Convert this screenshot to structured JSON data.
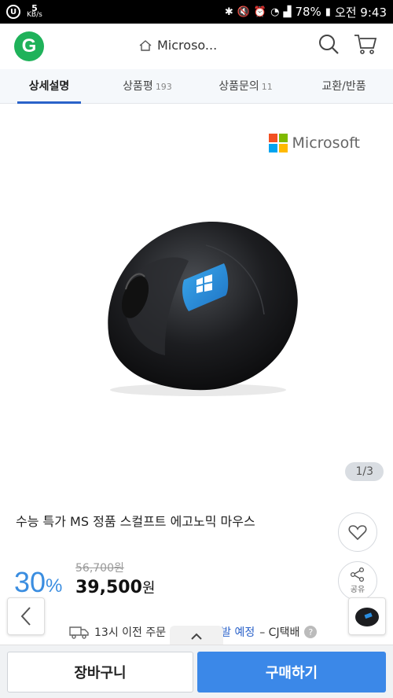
{
  "status_bar": {
    "speed_value": "5",
    "speed_unit": "KB/s",
    "battery": "78%",
    "time": "오전 9:43"
  },
  "header": {
    "logo_letter": "G",
    "title": "Microso..."
  },
  "tabs": [
    {
      "label": "상세설명",
      "count": ""
    },
    {
      "label": "상품평",
      "count": "193"
    },
    {
      "label": "상품문의",
      "count": "11"
    },
    {
      "label": "교환/반품",
      "count": ""
    }
  ],
  "image": {
    "brand_text": "Microsoft",
    "pager": "1/3"
  },
  "product": {
    "title": "수능 특가 MS 정품 스컬프트 에고노믹 마우스",
    "original_price": "56,700원",
    "discount_value": "30",
    "discount_unit": "%",
    "price_value": "39,500",
    "price_unit": "원",
    "share_label": "공유"
  },
  "delivery": {
    "text_before": "13시 이전 주문",
    "text_highlight": "발 예정",
    "text_after": "– CJ택배",
    "help": "?"
  },
  "bottom": {
    "cart_label": "장바구니",
    "buy_label": "구매하기"
  },
  "colors": {
    "accent": "#3b88e8",
    "logo_green": "#1fb25a",
    "discount_blue": "#3a8de0",
    "ms_red": "#f25022",
    "ms_green": "#7fba00",
    "ms_blue": "#00a4ef",
    "ms_yellow": "#ffb900"
  }
}
